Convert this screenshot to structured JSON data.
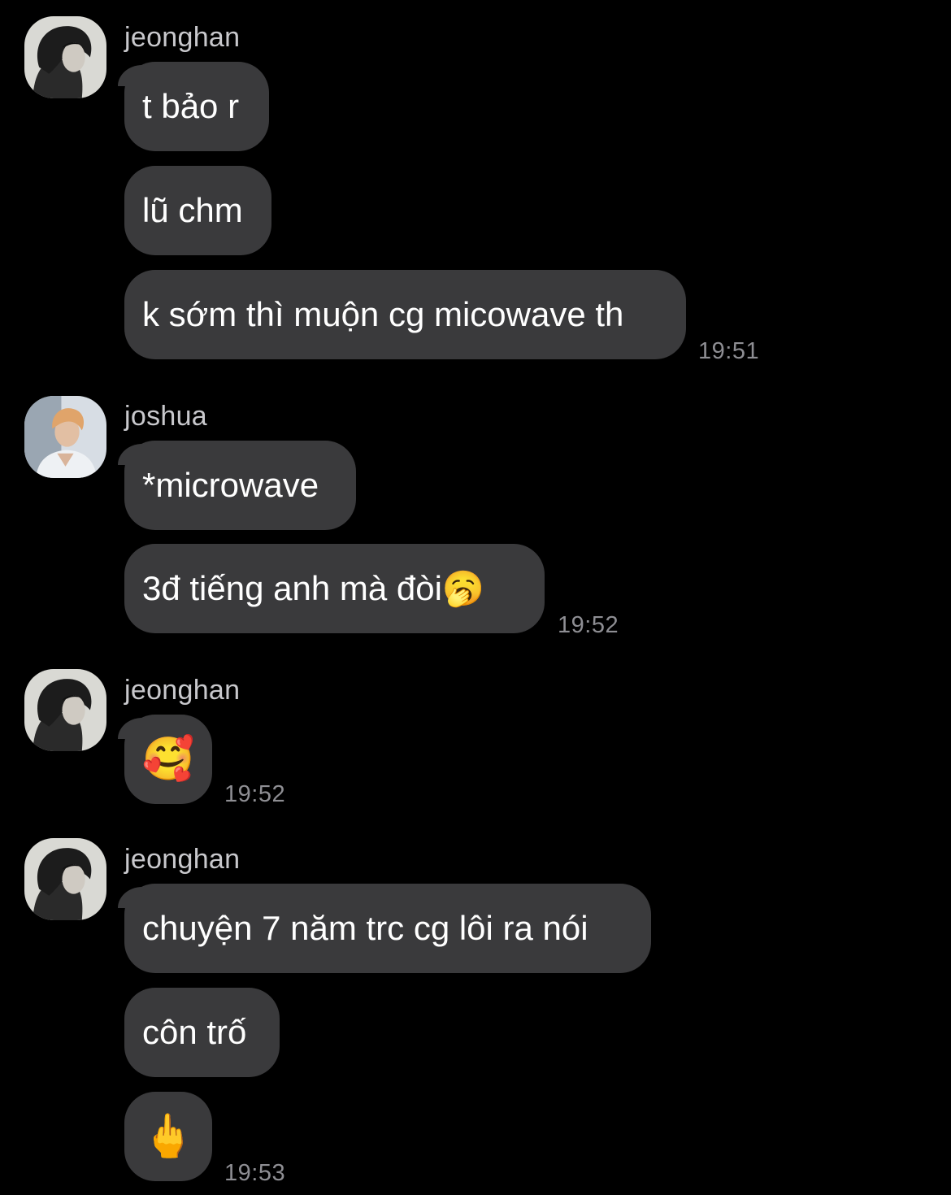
{
  "colors": {
    "background": "#000000",
    "bubble": "#3a3a3c",
    "sender_text": "#c8c8cc",
    "timestamp_text": "#8e8e93"
  },
  "groups": [
    {
      "sender": "jeonghan",
      "avatar_icon": "avatar-jeonghan-icon",
      "messages": [
        "t bảo r",
        "lũ chm",
        "k sớm thì muộn cg micowave th"
      ],
      "time": "19:51"
    },
    {
      "sender": "joshua",
      "avatar_icon": "avatar-joshua-icon",
      "messages": [
        "*microwave",
        "3đ tiếng anh mà đòi🥱"
      ],
      "time": "19:52"
    },
    {
      "sender": "jeonghan",
      "avatar_icon": "avatar-jeonghan-icon",
      "messages": [
        "🥰"
      ],
      "time": "19:52"
    },
    {
      "sender": "jeonghan",
      "avatar_icon": "avatar-jeonghan-icon",
      "messages": [
        "chuyện 7 năm trc cg lôi ra nói",
        "côn trố",
        "🖕"
      ],
      "time": "19:53"
    }
  ]
}
